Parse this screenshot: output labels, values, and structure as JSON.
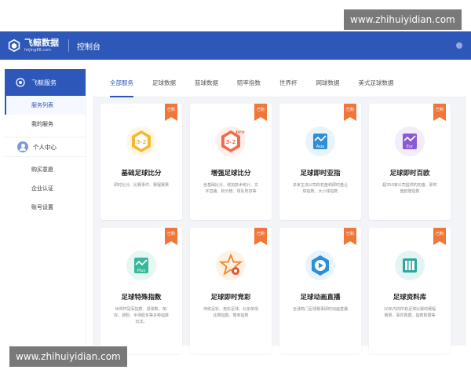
{
  "watermark": {
    "text": "www.zhihuiyidian.com"
  },
  "header": {
    "brand": "飞鲸数据",
    "brand_sub": "feijing88.com",
    "title": "控制台"
  },
  "sidebar": {
    "service_title": "飞鲸服务",
    "service_items": [
      {
        "label": "服务列表",
        "active": true
      },
      {
        "label": "我的服务",
        "active": false
      }
    ],
    "user_center": "个人中心",
    "user_items": [
      {
        "label": "购买意愿"
      },
      {
        "label": "企业认证"
      },
      {
        "label": "账号设置"
      }
    ]
  },
  "tabs": [
    {
      "label": "全部服务",
      "active": true
    },
    {
      "label": "足球数据"
    },
    {
      "label": "篮球数据"
    },
    {
      "label": "赔率指数"
    },
    {
      "label": "世界杯"
    },
    {
      "label": "网球数据"
    },
    {
      "label": "美式足球数据"
    }
  ],
  "cards": [
    {
      "title": "基础足球比分",
      "badge": "已购",
      "icon": "hexagon-3-2-icon",
      "icon_text": "3-2",
      "desc": "即时比分、比赛事件、赛程赛果"
    },
    {
      "title": "增强足球比分",
      "badge": "已购",
      "icon": "hexagon-3-2-pro-icon",
      "icon_text": "3-2",
      "icon_tag": "pro",
      "desc": "含基础比分、增加技术统计、文字直播、积分榜、球队阵容等"
    },
    {
      "title": "足球即时亚指",
      "badge": "已购",
      "icon": "asia-index-icon",
      "icon_text": "Asia",
      "desc": "多家主流公司的初盘和即时盘让球指数、大小球指数"
    },
    {
      "title": "足球即时百欧",
      "badge": "已购",
      "icon": "euro-index-icon",
      "icon_text": "Eur",
      "desc": "超350家公司提供的初盘、即时盘欧赔指数"
    },
    {
      "title": "足球特殊指数",
      "badge": "已购",
      "icon": "plus-index-icon",
      "icon_text": "Plus",
      "desc": "世界杯冠军指数、进球数、单/双、波胆、半场胜负等多种指数玩法。"
    },
    {
      "title": "足球即时竞彩",
      "badge": "已购",
      "icon": "star-ball-icon",
      "icon_text": "",
      "desc": "传统足彩、竞彩足球、北京单场比赛指数、赔率指数"
    },
    {
      "title": "足球动画直播",
      "badge": "已购",
      "icon": "play-video-icon",
      "icon_text": "",
      "desc": "全球热门足球赛事即时动画直播"
    },
    {
      "title": "足球资料库",
      "badge": "已购",
      "icon": "database-icon",
      "icon_text": "",
      "desc": "10年内的所有足球比赛的赛程赛果、事件数据、指数数据等"
    }
  ],
  "colors": {
    "primary": "#2d57b8",
    "ribbon": "#f0763a",
    "icon_yellow": "#f5b82e",
    "icon_orange": "#f06d4c",
    "icon_blue": "#2e8fd6",
    "icon_purple": "#8a5ad6",
    "icon_green": "#38b89a",
    "icon_amber": "#f08c32",
    "icon_teal": "#2aa8a0"
  }
}
